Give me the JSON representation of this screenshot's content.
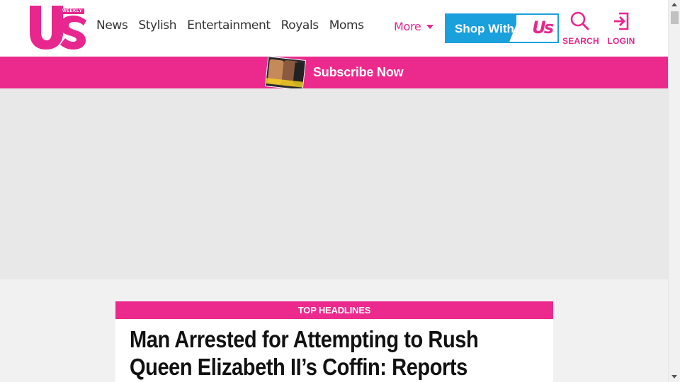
{
  "brand": {
    "logo_text": "Us",
    "logo_badge": "WEEKLY",
    "color_pink": "#e8278e",
    "color_blue": "#1aa0dc"
  },
  "nav": {
    "items": [
      {
        "label": "News"
      },
      {
        "label": "Stylish"
      },
      {
        "label": "Entertainment"
      },
      {
        "label": "Royals"
      },
      {
        "label": "Moms"
      }
    ],
    "more_label": "More"
  },
  "shop": {
    "label": "Shop With",
    "logo_text": "Us"
  },
  "actions": {
    "search_label": "SEARCH",
    "login_label": "LOGIN"
  },
  "subscribe": {
    "label": "Subscribe Now"
  },
  "headlines": {
    "tag": "TOP HEADLINES",
    "title": "Man Arrested for Attempting to Rush Queen Elizabeth II’s Coffin: Reports"
  }
}
